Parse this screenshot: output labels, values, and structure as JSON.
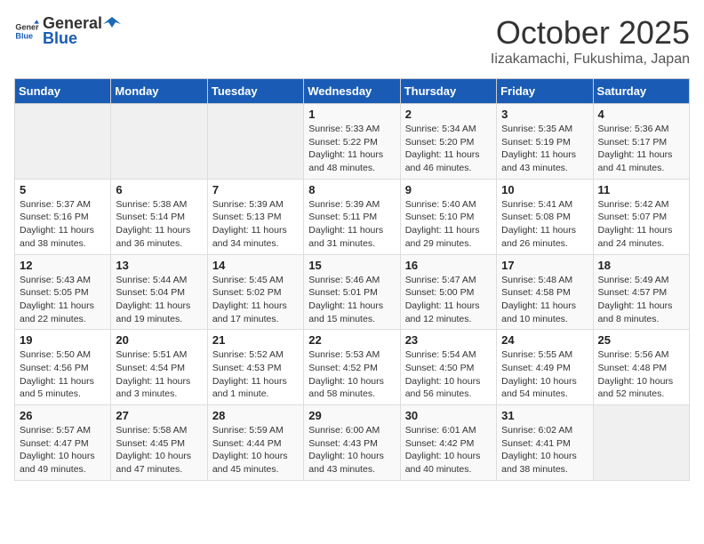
{
  "header": {
    "logo_general": "General",
    "logo_blue": "Blue",
    "month_title": "October 2025",
    "location": "Iizakamachi, Fukushima, Japan"
  },
  "weekdays": [
    "Sunday",
    "Monday",
    "Tuesday",
    "Wednesday",
    "Thursday",
    "Friday",
    "Saturday"
  ],
  "weeks": [
    [
      {
        "day": "",
        "sunrise": "",
        "sunset": "",
        "daylight": ""
      },
      {
        "day": "",
        "sunrise": "",
        "sunset": "",
        "daylight": ""
      },
      {
        "day": "",
        "sunrise": "",
        "sunset": "",
        "daylight": ""
      },
      {
        "day": "1",
        "sunrise": "Sunrise: 5:33 AM",
        "sunset": "Sunset: 5:22 PM",
        "daylight": "Daylight: 11 hours and 48 minutes."
      },
      {
        "day": "2",
        "sunrise": "Sunrise: 5:34 AM",
        "sunset": "Sunset: 5:20 PM",
        "daylight": "Daylight: 11 hours and 46 minutes."
      },
      {
        "day": "3",
        "sunrise": "Sunrise: 5:35 AM",
        "sunset": "Sunset: 5:19 PM",
        "daylight": "Daylight: 11 hours and 43 minutes."
      },
      {
        "day": "4",
        "sunrise": "Sunrise: 5:36 AM",
        "sunset": "Sunset: 5:17 PM",
        "daylight": "Daylight: 11 hours and 41 minutes."
      }
    ],
    [
      {
        "day": "5",
        "sunrise": "Sunrise: 5:37 AM",
        "sunset": "Sunset: 5:16 PM",
        "daylight": "Daylight: 11 hours and 38 minutes."
      },
      {
        "day": "6",
        "sunrise": "Sunrise: 5:38 AM",
        "sunset": "Sunset: 5:14 PM",
        "daylight": "Daylight: 11 hours and 36 minutes."
      },
      {
        "day": "7",
        "sunrise": "Sunrise: 5:39 AM",
        "sunset": "Sunset: 5:13 PM",
        "daylight": "Daylight: 11 hours and 34 minutes."
      },
      {
        "day": "8",
        "sunrise": "Sunrise: 5:39 AM",
        "sunset": "Sunset: 5:11 PM",
        "daylight": "Daylight: 11 hours and 31 minutes."
      },
      {
        "day": "9",
        "sunrise": "Sunrise: 5:40 AM",
        "sunset": "Sunset: 5:10 PM",
        "daylight": "Daylight: 11 hours and 29 minutes."
      },
      {
        "day": "10",
        "sunrise": "Sunrise: 5:41 AM",
        "sunset": "Sunset: 5:08 PM",
        "daylight": "Daylight: 11 hours and 26 minutes."
      },
      {
        "day": "11",
        "sunrise": "Sunrise: 5:42 AM",
        "sunset": "Sunset: 5:07 PM",
        "daylight": "Daylight: 11 hours and 24 minutes."
      }
    ],
    [
      {
        "day": "12",
        "sunrise": "Sunrise: 5:43 AM",
        "sunset": "Sunset: 5:05 PM",
        "daylight": "Daylight: 11 hours and 22 minutes."
      },
      {
        "day": "13",
        "sunrise": "Sunrise: 5:44 AM",
        "sunset": "Sunset: 5:04 PM",
        "daylight": "Daylight: 11 hours and 19 minutes."
      },
      {
        "day": "14",
        "sunrise": "Sunrise: 5:45 AM",
        "sunset": "Sunset: 5:02 PM",
        "daylight": "Daylight: 11 hours and 17 minutes."
      },
      {
        "day": "15",
        "sunrise": "Sunrise: 5:46 AM",
        "sunset": "Sunset: 5:01 PM",
        "daylight": "Daylight: 11 hours and 15 minutes."
      },
      {
        "day": "16",
        "sunrise": "Sunrise: 5:47 AM",
        "sunset": "Sunset: 5:00 PM",
        "daylight": "Daylight: 11 hours and 12 minutes."
      },
      {
        "day": "17",
        "sunrise": "Sunrise: 5:48 AM",
        "sunset": "Sunset: 4:58 PM",
        "daylight": "Daylight: 11 hours and 10 minutes."
      },
      {
        "day": "18",
        "sunrise": "Sunrise: 5:49 AM",
        "sunset": "Sunset: 4:57 PM",
        "daylight": "Daylight: 11 hours and 8 minutes."
      }
    ],
    [
      {
        "day": "19",
        "sunrise": "Sunrise: 5:50 AM",
        "sunset": "Sunset: 4:56 PM",
        "daylight": "Daylight: 11 hours and 5 minutes."
      },
      {
        "day": "20",
        "sunrise": "Sunrise: 5:51 AM",
        "sunset": "Sunset: 4:54 PM",
        "daylight": "Daylight: 11 hours and 3 minutes."
      },
      {
        "day": "21",
        "sunrise": "Sunrise: 5:52 AM",
        "sunset": "Sunset: 4:53 PM",
        "daylight": "Daylight: 11 hours and 1 minute."
      },
      {
        "day": "22",
        "sunrise": "Sunrise: 5:53 AM",
        "sunset": "Sunset: 4:52 PM",
        "daylight": "Daylight: 10 hours and 58 minutes."
      },
      {
        "day": "23",
        "sunrise": "Sunrise: 5:54 AM",
        "sunset": "Sunset: 4:50 PM",
        "daylight": "Daylight: 10 hours and 56 minutes."
      },
      {
        "day": "24",
        "sunrise": "Sunrise: 5:55 AM",
        "sunset": "Sunset: 4:49 PM",
        "daylight": "Daylight: 10 hours and 54 minutes."
      },
      {
        "day": "25",
        "sunrise": "Sunrise: 5:56 AM",
        "sunset": "Sunset: 4:48 PM",
        "daylight": "Daylight: 10 hours and 52 minutes."
      }
    ],
    [
      {
        "day": "26",
        "sunrise": "Sunrise: 5:57 AM",
        "sunset": "Sunset: 4:47 PM",
        "daylight": "Daylight: 10 hours and 49 minutes."
      },
      {
        "day": "27",
        "sunrise": "Sunrise: 5:58 AM",
        "sunset": "Sunset: 4:45 PM",
        "daylight": "Daylight: 10 hours and 47 minutes."
      },
      {
        "day": "28",
        "sunrise": "Sunrise: 5:59 AM",
        "sunset": "Sunset: 4:44 PM",
        "daylight": "Daylight: 10 hours and 45 minutes."
      },
      {
        "day": "29",
        "sunrise": "Sunrise: 6:00 AM",
        "sunset": "Sunset: 4:43 PM",
        "daylight": "Daylight: 10 hours and 43 minutes."
      },
      {
        "day": "30",
        "sunrise": "Sunrise: 6:01 AM",
        "sunset": "Sunset: 4:42 PM",
        "daylight": "Daylight: 10 hours and 40 minutes."
      },
      {
        "day": "31",
        "sunrise": "Sunrise: 6:02 AM",
        "sunset": "Sunset: 4:41 PM",
        "daylight": "Daylight: 10 hours and 38 minutes."
      },
      {
        "day": "",
        "sunrise": "",
        "sunset": "",
        "daylight": ""
      }
    ]
  ]
}
